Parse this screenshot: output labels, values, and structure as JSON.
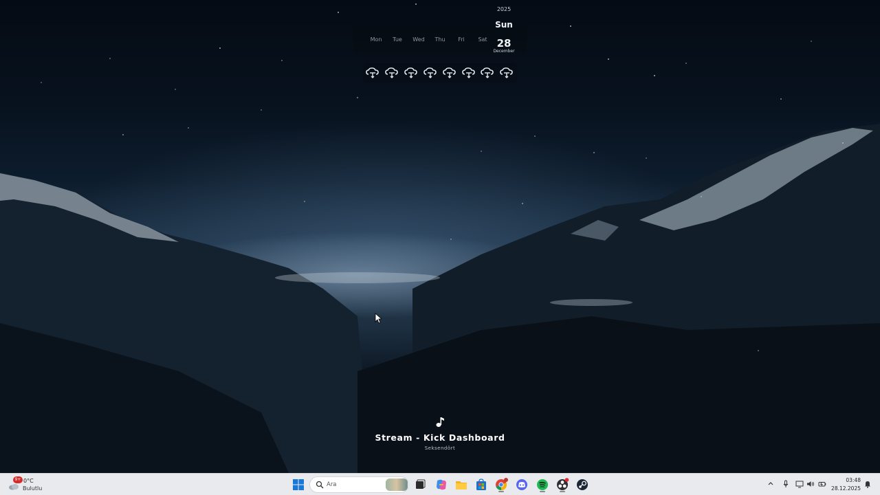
{
  "widgets": {
    "calendar": {
      "year": "2025",
      "days": [
        "Mon",
        "Tue",
        "Wed",
        "Thu",
        "Fri",
        "Sat"
      ],
      "today_name": "Sun",
      "today_number": "28",
      "month": "December"
    },
    "weather_forecast": {
      "icon": "cloud-rain-icon",
      "count": 8
    }
  },
  "now_playing": {
    "icon": "music-note-icon",
    "title": "Stream - Kick Dashboard",
    "artist": "Seksendört"
  },
  "taskbar": {
    "weather": {
      "badge": "9+",
      "temperature": "0°C",
      "condition": "Bulutlu"
    },
    "search": {
      "placeholder": "Ara"
    },
    "apps": [
      "start-icon",
      "search",
      "task-view-icon",
      "copilot-icon",
      "file-explorer-icon",
      "microsoft-store-icon",
      "chrome-icon",
      "discord-icon",
      "spotify-icon",
      "obs-icon",
      "steam-icon"
    ],
    "tray": [
      "chevron-up-icon",
      "microphone-icon",
      "display-icon",
      "speaker-icon",
      "battery-icon"
    ],
    "clock": {
      "time": "03:48",
      "date": "28.12.2025"
    }
  }
}
